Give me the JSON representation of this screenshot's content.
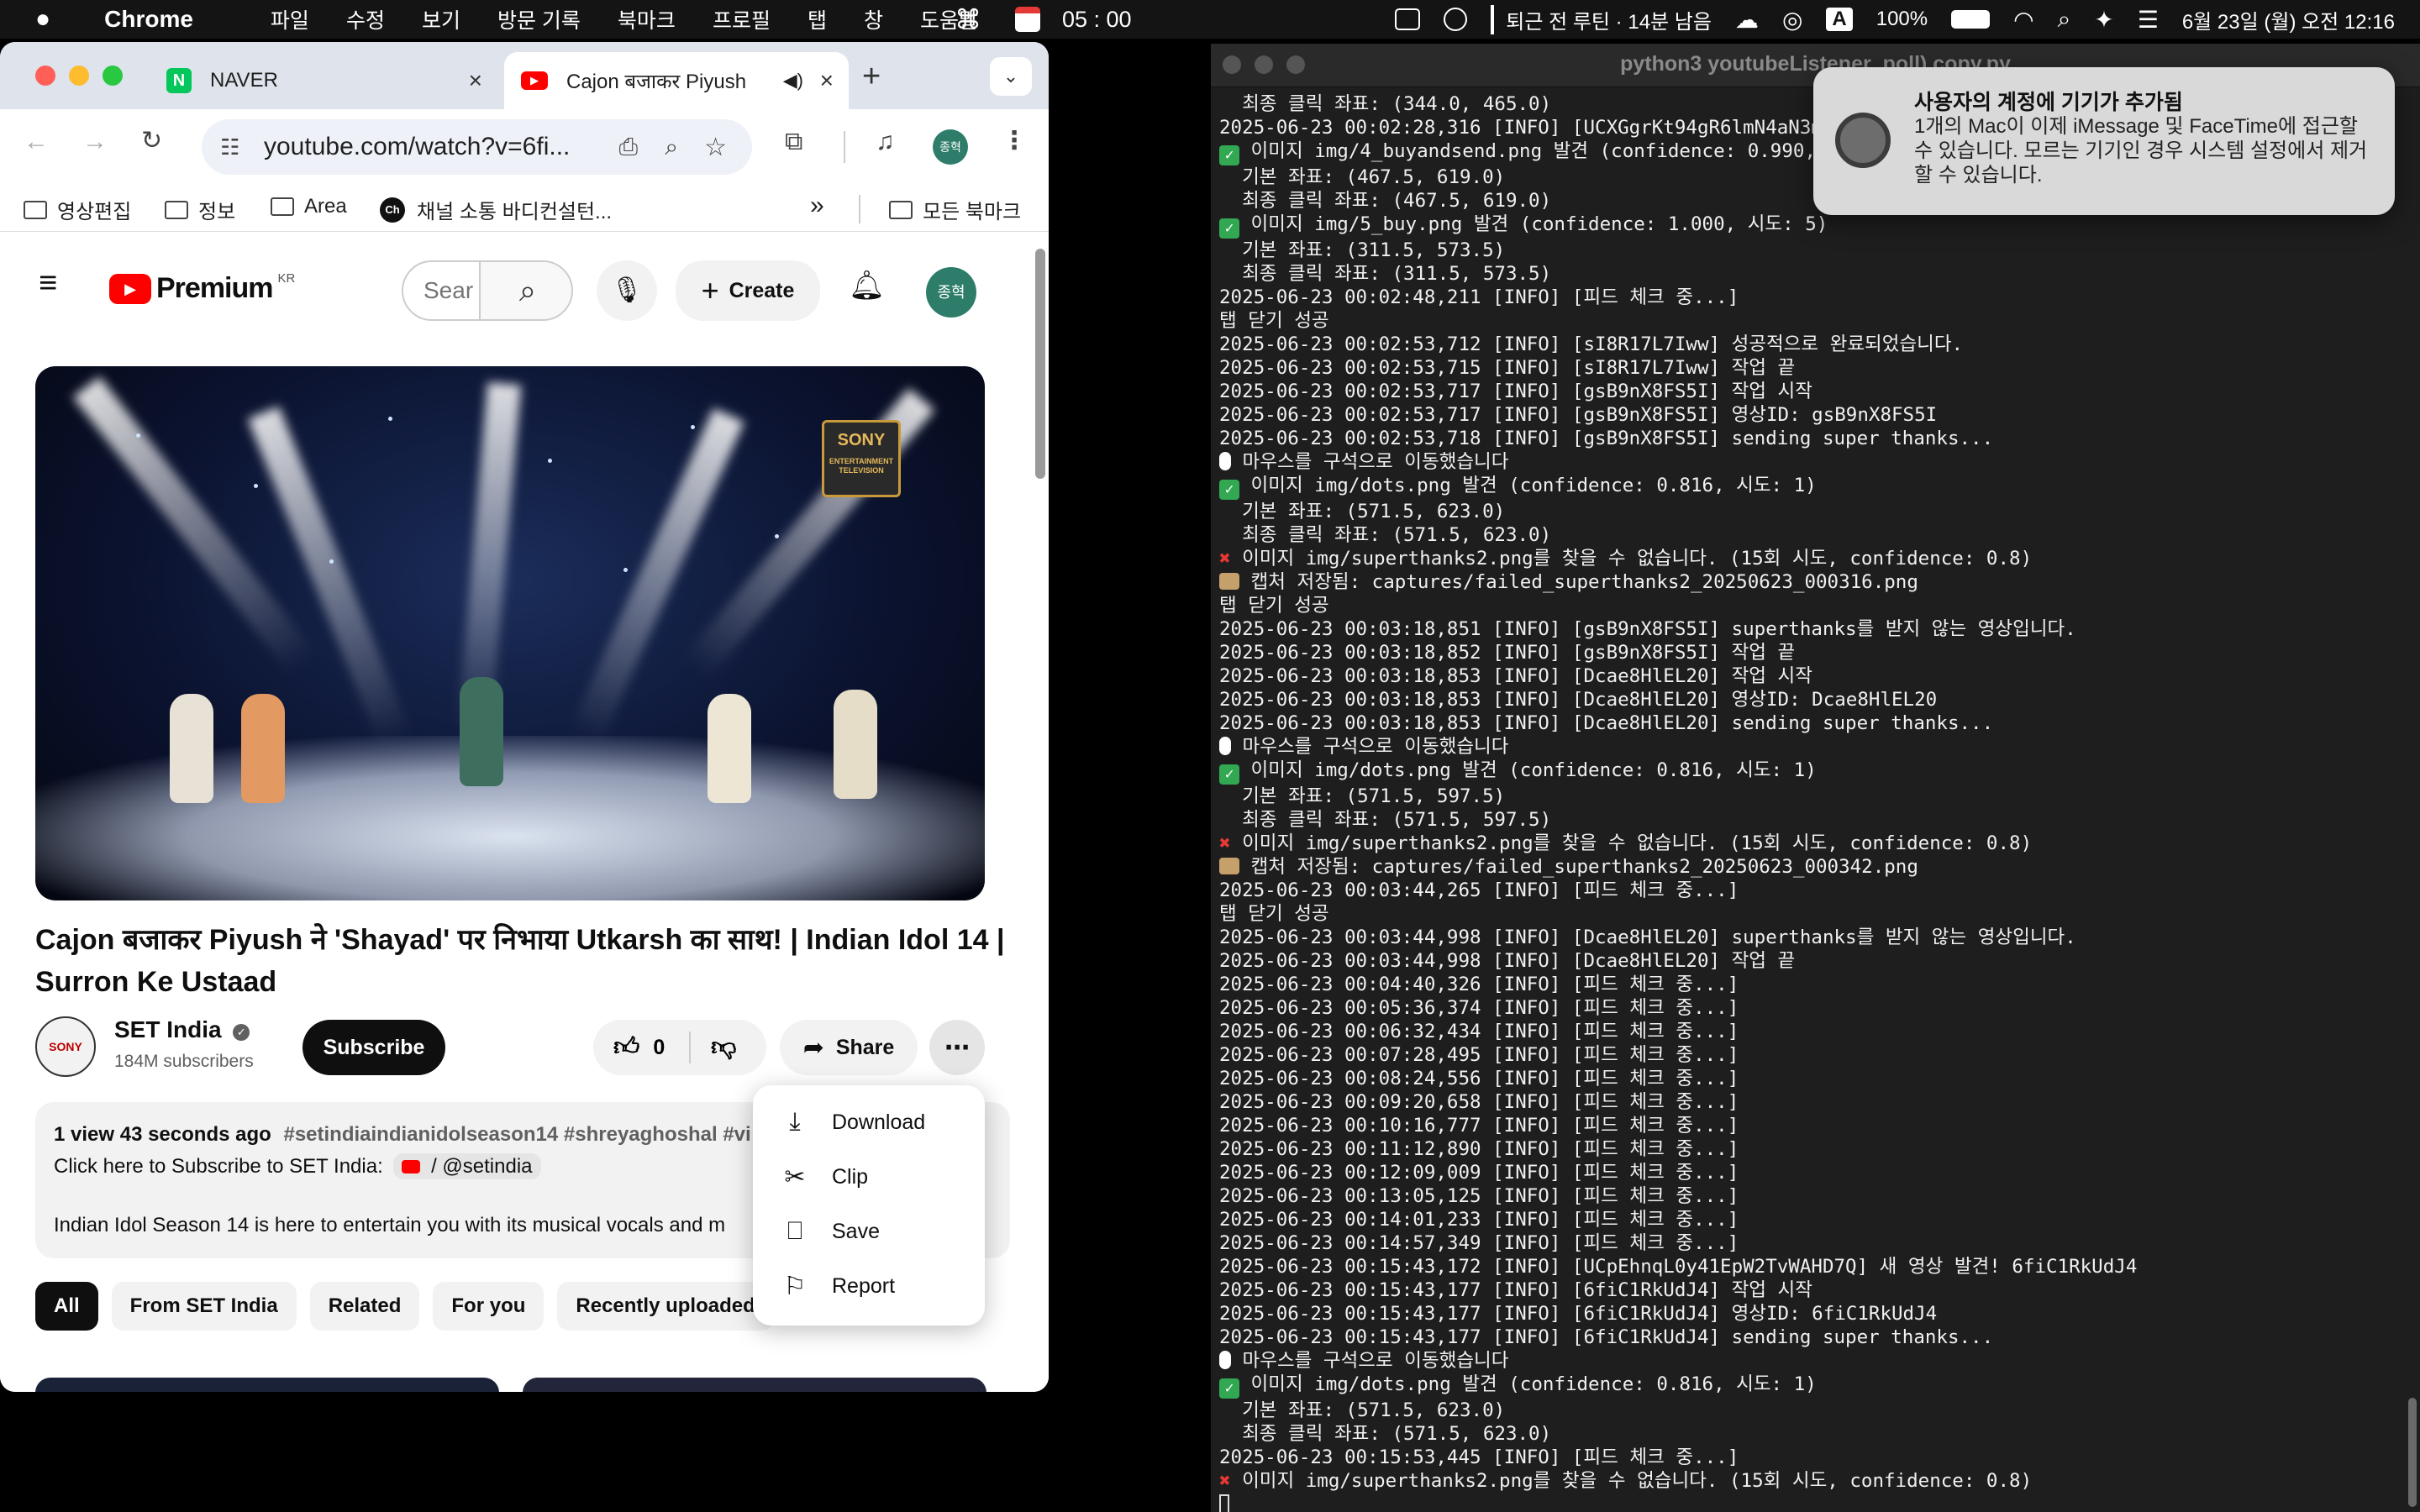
{
  "menubar": {
    "app": "Chrome",
    "items": [
      "파일",
      "수정",
      "보기",
      "방문 기록",
      "북마크",
      "프로필",
      "탭",
      "창",
      "도움말"
    ],
    "timer": "05 : 00",
    "reminder": "퇴근 전 루틴 · 14분 남음",
    "input_source": "A",
    "battery": "100%",
    "datetime": "6월 23일 (월) 오전 12:16"
  },
  "chrome": {
    "tabs": [
      {
        "title": "NAVER",
        "favicon": "N",
        "color": "#03c75a"
      },
      {
        "title": "Cajon बजाकर Piyush",
        "favicon": "▶",
        "color": "#ff0000"
      }
    ],
    "url": "youtube.com/watch?v=6fi...",
    "profile_initial": "종혁",
    "bookmarks": [
      "영상편집",
      "정보",
      "Area",
      "채널 소통 바디컨설턴...",
      "모든 북마크"
    ],
    "bookmark_ch": "Ch",
    "overflow": "»"
  },
  "youtube": {
    "logo": "Premium",
    "region": "KR",
    "search_placeholder": "Sear",
    "create": "Create",
    "avatar": "종혁",
    "player_logo_top": "SONY",
    "player_logo_bottom": "ENTERTAINMENT TELEVISION",
    "title": "Cajon बजाकर Piyush ने 'Shayad' पर निभाया Utkarsh का साथ! | Indian Idol 14 | Surron Ke Ustaad",
    "channel": "SET India",
    "subscribers": "184M subscribers",
    "subscribe": "Subscribe",
    "likes": "0",
    "share": "Share",
    "description": {
      "meta": "1 view  43 seconds ago",
      "tags": "#setindiaindianidolseason14 #shreyaghoshal #vi",
      "line2_prefix": "Click here to Subscribe to SET India:",
      "line2_handle": "/ @setindia",
      "line3": "Indian Idol Season 14 is here to entertain you with its musical vocals and m"
    },
    "menu": [
      {
        "label": "Download",
        "icon": "download-icon"
      },
      {
        "label": "Clip",
        "icon": "scissors-icon"
      },
      {
        "label": "Save",
        "icon": "bookmark-icon"
      },
      {
        "label": "Report",
        "icon": "flag-icon"
      }
    ],
    "chips": [
      "All",
      "From SET India",
      "Related",
      "For you",
      "Recently uploaded"
    ]
  },
  "terminal": {
    "title": "python3 youtubeListener_poll) copy.py",
    "lines": [
      {
        "t": "  최종 클릭 좌표: (344.0, 465.0)"
      },
      {
        "t": "2025-06-23 00:02:28,316 [INFO] [UCXGgrKt94gR6lmN4aN3mYTg] 시"
      },
      {
        "icon": "ok",
        "t": "이미지 img/4_buyandsend.png 발견 (confidence: 0.990, 시도"
      },
      {
        "t": "  기본 좌표: (467.5, 619.0)"
      },
      {
        "t": "  최종 클릭 좌표: (467.5, 619.0)"
      },
      {
        "icon": "ok",
        "t": "이미지 img/5_buy.png 발견 (confidence: 1.000, 시도: 5)"
      },
      {
        "t": "  기본 좌표: (311.5, 573.5)"
      },
      {
        "t": "  최종 클릭 좌표: (311.5, 573.5)"
      },
      {
        "t": "2025-06-23 00:02:48,211 [INFO] [피드 체크 중...]"
      },
      {
        "t": "탭 닫기 성공"
      },
      {
        "t": "2025-06-23 00:02:53,712 [INFO] [sI8R17L7Iww] 성공적으로 완료되었습니다."
      },
      {
        "t": "2025-06-23 00:02:53,715 [INFO] [sI8R17L7Iww] 작업 끝"
      },
      {
        "t": "2025-06-23 00:02:53,717 [INFO] [gsB9nX8FS5I] 작업 시작"
      },
      {
        "t": "2025-06-23 00:02:53,717 [INFO] [gsB9nX8FS5I] 영상ID: gsB9nX8FS5I"
      },
      {
        "t": "2025-06-23 00:02:53,718 [INFO] [gsB9nX8FS5I] sending super thanks..."
      },
      {
        "icon": "mouse",
        "t": "마우스를 구석으로 이동했습니다"
      },
      {
        "icon": "ok",
        "t": "이미지 img/dots.png 발견 (confidence: 0.816, 시도: 1)"
      },
      {
        "t": "  기본 좌표: (571.5, 623.0)"
      },
      {
        "t": "  최종 클릭 좌표: (571.5, 623.0)"
      },
      {
        "icon": "err",
        "t": "이미지 img/superthanks2.png를 찾을 수 없습니다. (15회 시도, confidence: 0.8)"
      },
      {
        "icon": "cam",
        "t": "캡처 저장됨: captures/failed_superthanks2_20250623_000316.png"
      },
      {
        "t": "탭 닫기 성공"
      },
      {
        "t": "2025-06-23 00:03:18,851 [INFO] [gsB9nX8FS5I] superthanks를 받지 않는 영상입니다."
      },
      {
        "t": "2025-06-23 00:03:18,852 [INFO] [gsB9nX8FS5I] 작업 끝"
      },
      {
        "t": "2025-06-23 00:03:18,853 [INFO] [Dcae8HlEL20] 작업 시작"
      },
      {
        "t": "2025-06-23 00:03:18,853 [INFO] [Dcae8HlEL20] 영상ID: Dcae8HlEL20"
      },
      {
        "t": "2025-06-23 00:03:18,853 [INFO] [Dcae8HlEL20] sending super thanks..."
      },
      {
        "icon": "mouse",
        "t": "마우스를 구석으로 이동했습니다"
      },
      {
        "icon": "ok",
        "t": "이미지 img/dots.png 발견 (confidence: 0.816, 시도: 1)"
      },
      {
        "t": "  기본 좌표: (571.5, 597.5)"
      },
      {
        "t": "  최종 클릭 좌표: (571.5, 597.5)"
      },
      {
        "icon": "err",
        "t": "이미지 img/superthanks2.png를 찾을 수 없습니다. (15회 시도, confidence: 0.8)"
      },
      {
        "icon": "cam",
        "t": "캡처 저장됨: captures/failed_superthanks2_20250623_000342.png"
      },
      {
        "t": "2025-06-23 00:03:44,265 [INFO] [피드 체크 중...]"
      },
      {
        "t": "탭 닫기 성공"
      },
      {
        "t": "2025-06-23 00:03:44,998 [INFO] [Dcae8HlEL20] superthanks를 받지 않는 영상입니다."
      },
      {
        "t": "2025-06-23 00:03:44,998 [INFO] [Dcae8HlEL20] 작업 끝"
      },
      {
        "t": "2025-06-23 00:04:40,326 [INFO] [피드 체크 중...]"
      },
      {
        "t": "2025-06-23 00:05:36,374 [INFO] [피드 체크 중...]"
      },
      {
        "t": "2025-06-23 00:06:32,434 [INFO] [피드 체크 중...]"
      },
      {
        "t": "2025-06-23 00:07:28,495 [INFO] [피드 체크 중...]"
      },
      {
        "t": "2025-06-23 00:08:24,556 [INFO] [피드 체크 중...]"
      },
      {
        "t": "2025-06-23 00:09:20,658 [INFO] [피드 체크 중...]"
      },
      {
        "t": "2025-06-23 00:10:16,777 [INFO] [피드 체크 중...]"
      },
      {
        "t": "2025-06-23 00:11:12,890 [INFO] [피드 체크 중...]"
      },
      {
        "t": "2025-06-23 00:12:09,009 [INFO] [피드 체크 중...]"
      },
      {
        "t": "2025-06-23 00:13:05,125 [INFO] [피드 체크 중...]"
      },
      {
        "t": "2025-06-23 00:14:01,233 [INFO] [피드 체크 중...]"
      },
      {
        "t": "2025-06-23 00:14:57,349 [INFO] [피드 체크 중...]"
      },
      {
        "t": "2025-06-23 00:15:43,172 [INFO] [UCpEhnqL0y41EpW2TvWAHD7Q] 새 영상 발견! 6fiC1RkUdJ4"
      },
      {
        "t": "2025-06-23 00:15:43,177 [INFO] [6fiC1RkUdJ4] 작업 시작"
      },
      {
        "t": "2025-06-23 00:15:43,177 [INFO] [6fiC1RkUdJ4] 영상ID: 6fiC1RkUdJ4"
      },
      {
        "t": "2025-06-23 00:15:43,177 [INFO] [6fiC1RkUdJ4] sending super thanks..."
      },
      {
        "icon": "mouse",
        "t": "마우스를 구석으로 이동했습니다"
      },
      {
        "icon": "ok",
        "t": "이미지 img/dots.png 발견 (confidence: 0.816, 시도: 1)"
      },
      {
        "t": "  기본 좌표: (571.5, 623.0)"
      },
      {
        "t": "  최종 클릭 좌표: (571.5, 623.0)"
      },
      {
        "t": "2025-06-23 00:15:53,445 [INFO] [피드 체크 중...]"
      },
      {
        "icon": "err",
        "t": "이미지 img/superthanks2.png를 찾을 수 없습니다. (15회 시도, confidence: 0.8)"
      }
    ]
  },
  "notification": {
    "title": "사용자의 계정에 기기가 추가됨",
    "body": "1개의 Mac이 이제 iMessage 및 FaceTime에 접근할 수 있습니다. 모르는 기기인 경우 시스템 설정에서 제거할 수 있습니다."
  }
}
